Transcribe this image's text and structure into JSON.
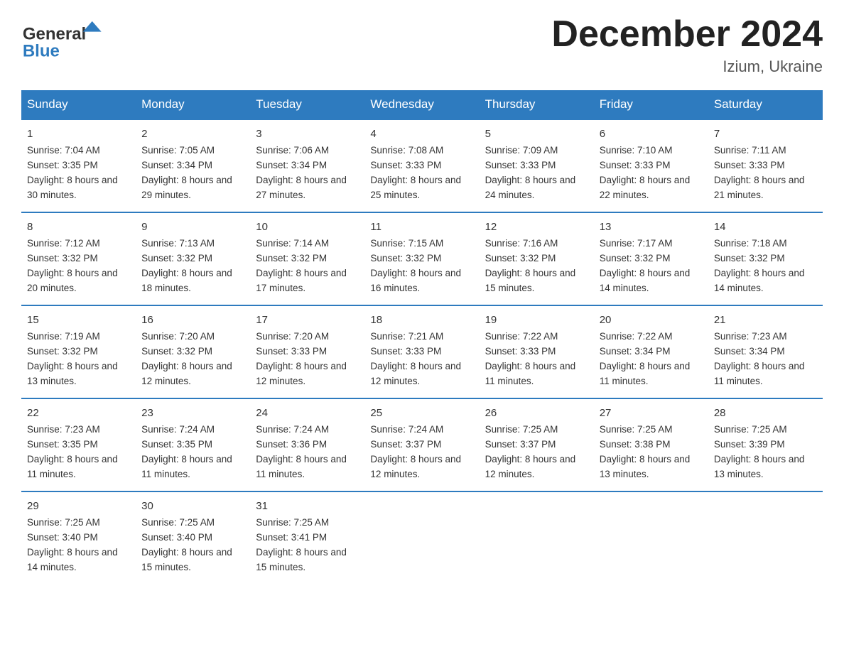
{
  "header": {
    "logo_general": "General",
    "logo_blue": "Blue",
    "title": "December 2024",
    "subtitle": "Izium, Ukraine"
  },
  "days_of_week": [
    "Sunday",
    "Monday",
    "Tuesday",
    "Wednesday",
    "Thursday",
    "Friday",
    "Saturday"
  ],
  "weeks": [
    [
      {
        "day": "1",
        "sunrise": "7:04 AM",
        "sunset": "3:35 PM",
        "daylight": "8 hours and 30 minutes."
      },
      {
        "day": "2",
        "sunrise": "7:05 AM",
        "sunset": "3:34 PM",
        "daylight": "8 hours and 29 minutes."
      },
      {
        "day": "3",
        "sunrise": "7:06 AM",
        "sunset": "3:34 PM",
        "daylight": "8 hours and 27 minutes."
      },
      {
        "day": "4",
        "sunrise": "7:08 AM",
        "sunset": "3:33 PM",
        "daylight": "8 hours and 25 minutes."
      },
      {
        "day": "5",
        "sunrise": "7:09 AM",
        "sunset": "3:33 PM",
        "daylight": "8 hours and 24 minutes."
      },
      {
        "day": "6",
        "sunrise": "7:10 AM",
        "sunset": "3:33 PM",
        "daylight": "8 hours and 22 minutes."
      },
      {
        "day": "7",
        "sunrise": "7:11 AM",
        "sunset": "3:33 PM",
        "daylight": "8 hours and 21 minutes."
      }
    ],
    [
      {
        "day": "8",
        "sunrise": "7:12 AM",
        "sunset": "3:32 PM",
        "daylight": "8 hours and 20 minutes."
      },
      {
        "day": "9",
        "sunrise": "7:13 AM",
        "sunset": "3:32 PM",
        "daylight": "8 hours and 18 minutes."
      },
      {
        "day": "10",
        "sunrise": "7:14 AM",
        "sunset": "3:32 PM",
        "daylight": "8 hours and 17 minutes."
      },
      {
        "day": "11",
        "sunrise": "7:15 AM",
        "sunset": "3:32 PM",
        "daylight": "8 hours and 16 minutes."
      },
      {
        "day": "12",
        "sunrise": "7:16 AM",
        "sunset": "3:32 PM",
        "daylight": "8 hours and 15 minutes."
      },
      {
        "day": "13",
        "sunrise": "7:17 AM",
        "sunset": "3:32 PM",
        "daylight": "8 hours and 14 minutes."
      },
      {
        "day": "14",
        "sunrise": "7:18 AM",
        "sunset": "3:32 PM",
        "daylight": "8 hours and 14 minutes."
      }
    ],
    [
      {
        "day": "15",
        "sunrise": "7:19 AM",
        "sunset": "3:32 PM",
        "daylight": "8 hours and 13 minutes."
      },
      {
        "day": "16",
        "sunrise": "7:20 AM",
        "sunset": "3:32 PM",
        "daylight": "8 hours and 12 minutes."
      },
      {
        "day": "17",
        "sunrise": "7:20 AM",
        "sunset": "3:33 PM",
        "daylight": "8 hours and 12 minutes."
      },
      {
        "day": "18",
        "sunrise": "7:21 AM",
        "sunset": "3:33 PM",
        "daylight": "8 hours and 12 minutes."
      },
      {
        "day": "19",
        "sunrise": "7:22 AM",
        "sunset": "3:33 PM",
        "daylight": "8 hours and 11 minutes."
      },
      {
        "day": "20",
        "sunrise": "7:22 AM",
        "sunset": "3:34 PM",
        "daylight": "8 hours and 11 minutes."
      },
      {
        "day": "21",
        "sunrise": "7:23 AM",
        "sunset": "3:34 PM",
        "daylight": "8 hours and 11 minutes."
      }
    ],
    [
      {
        "day": "22",
        "sunrise": "7:23 AM",
        "sunset": "3:35 PM",
        "daylight": "8 hours and 11 minutes."
      },
      {
        "day": "23",
        "sunrise": "7:24 AM",
        "sunset": "3:35 PM",
        "daylight": "8 hours and 11 minutes."
      },
      {
        "day": "24",
        "sunrise": "7:24 AM",
        "sunset": "3:36 PM",
        "daylight": "8 hours and 11 minutes."
      },
      {
        "day": "25",
        "sunrise": "7:24 AM",
        "sunset": "3:37 PM",
        "daylight": "8 hours and 12 minutes."
      },
      {
        "day": "26",
        "sunrise": "7:25 AM",
        "sunset": "3:37 PM",
        "daylight": "8 hours and 12 minutes."
      },
      {
        "day": "27",
        "sunrise": "7:25 AM",
        "sunset": "3:38 PM",
        "daylight": "8 hours and 13 minutes."
      },
      {
        "day": "28",
        "sunrise": "7:25 AM",
        "sunset": "3:39 PM",
        "daylight": "8 hours and 13 minutes."
      }
    ],
    [
      {
        "day": "29",
        "sunrise": "7:25 AM",
        "sunset": "3:40 PM",
        "daylight": "8 hours and 14 minutes."
      },
      {
        "day": "30",
        "sunrise": "7:25 AM",
        "sunset": "3:40 PM",
        "daylight": "8 hours and 15 minutes."
      },
      {
        "day": "31",
        "sunrise": "7:25 AM",
        "sunset": "3:41 PM",
        "daylight": "8 hours and 15 minutes."
      },
      null,
      null,
      null,
      null
    ]
  ],
  "labels": {
    "sunrise": "Sunrise:",
    "sunset": "Sunset:",
    "daylight": "Daylight:"
  }
}
